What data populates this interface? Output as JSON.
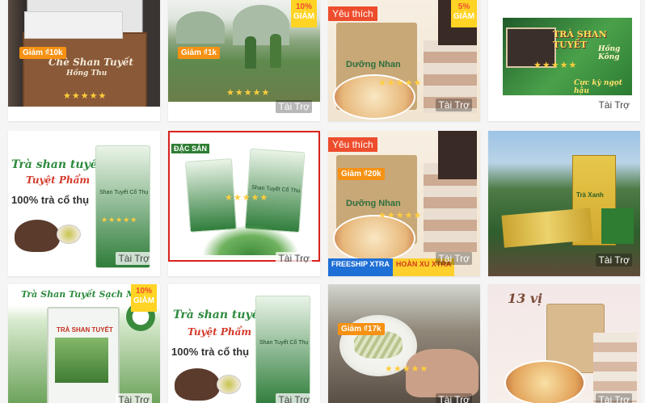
{
  "sponsored_label": "Tài Trợ",
  "favorite_label": "Yêu thích",
  "discount_suffix": "GIẢM",
  "stars": "★★★★★",
  "colors": {
    "voucher": "#f69113",
    "favorite": "#ee4d2d",
    "discount_bg": "#ffd424",
    "star": "#ffce3d"
  },
  "cards": {
    "c1": {
      "voucher": "Giảm ₫10k",
      "box_title": "Chè Shan Tuyết",
      "box_sub": "Hồng Thu"
    },
    "c2": {
      "voucher": "Giảm ₫1k",
      "discount": "10%"
    },
    "c3": {
      "discount": "5%",
      "pack_label": "Dưỡng Nhan"
    },
    "c4": {
      "title": "TRÀ SHAN TUYẾT",
      "subtitle": "Hồng Kông",
      "tagline": "Cực kỳ ngọt hậu"
    },
    "c5": {
      "title": "Trà shan tuyết",
      "subtitle": "Tuyệt Phẩm",
      "tagline": "100% trà cổ thụ",
      "pack_label": "Shan Tuyết Cổ Thụ"
    },
    "c6": {
      "badge": "ĐẶC SẢN",
      "pack_label": "Shan Tuyết Cổ Thụ"
    },
    "c7": {
      "voucher": "Giảm ₫20k",
      "pack_label": "Dưỡng Nhan",
      "promo_freeship": "FREESHIP XTRA",
      "promo_hoanxu": "HOÀN XU XTRA"
    },
    "c8": {
      "pack_label": "Trà Xanh"
    },
    "c9": {
      "title": "Trà Shan Tuyết Sạch Mộc",
      "discount": "10%",
      "pack_label": "TRÀ SHAN TUYẾT"
    },
    "c10": {
      "title": "Trà shan tuyết",
      "subtitle": "Tuyệt Phẩm",
      "tagline": "100% trà cổ thụ",
      "pack_label": "Shan Tuyết Cổ Thụ"
    },
    "c11": {
      "voucher": "Giảm ₫17k"
    },
    "c12": {
      "title": "13 vị"
    }
  }
}
